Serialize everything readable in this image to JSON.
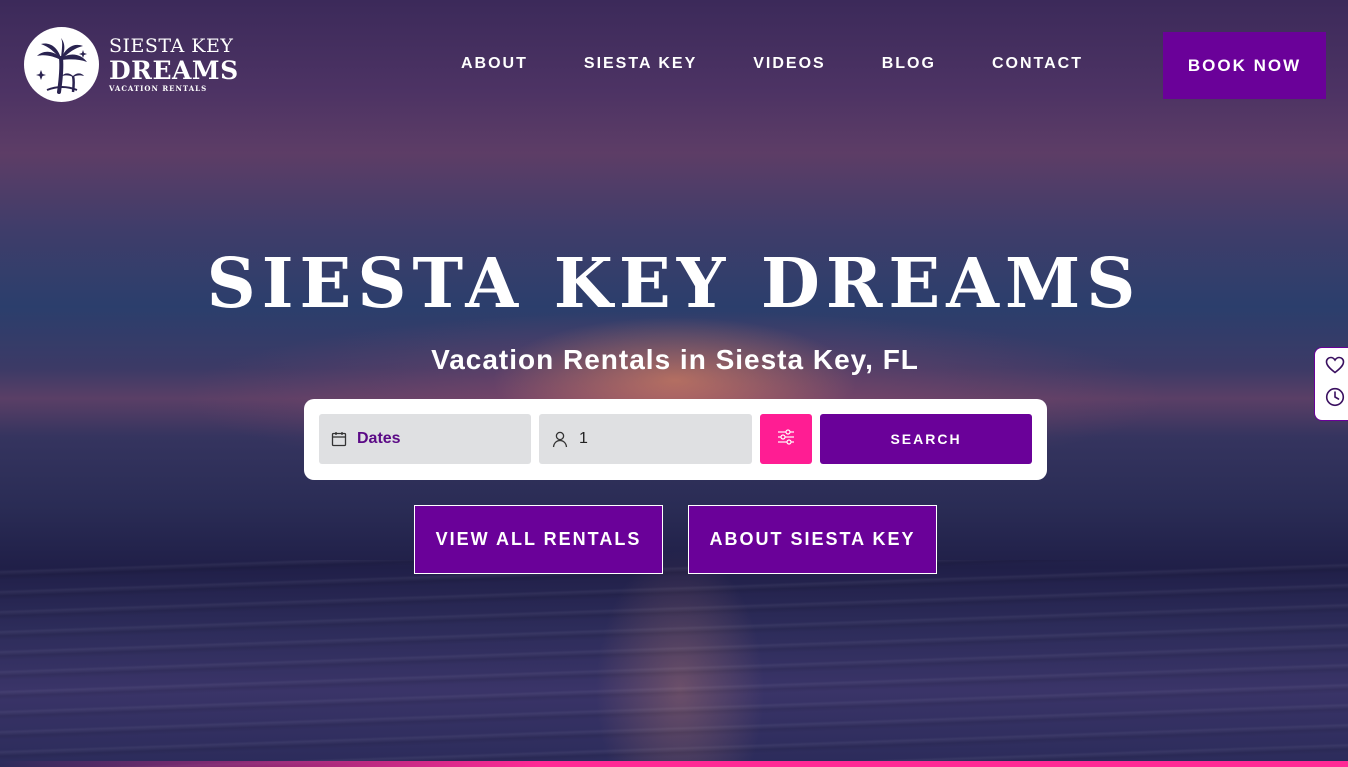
{
  "brand": {
    "line1": "SIESTA KEY",
    "line2": "DREAMS",
    "line3": "VACATION RENTALS",
    "logo_icon": "palm-tree-icon"
  },
  "nav": {
    "items": [
      {
        "label": "ABOUT"
      },
      {
        "label": "SIESTA KEY"
      },
      {
        "label": "VIDEOS"
      },
      {
        "label": "BLOG"
      },
      {
        "label": "CONTACT"
      }
    ],
    "book_now": "BOOK NOW"
  },
  "hero": {
    "title": "SIESTA KEY DREAMS",
    "subtitle": "Vacation Rentals in Siesta Key, FL"
  },
  "search": {
    "dates_label": "Dates",
    "dates_icon": "calendar-icon",
    "guests_value": "1",
    "guests_icon": "person-icon",
    "filter_icon": "sliders-icon",
    "search_label": "SEARCH"
  },
  "cta": {
    "rentals": "VIEW ALL RENTALS",
    "about": "ABOUT SIESTA KEY"
  },
  "side_widget": {
    "icons": [
      "heart-icon",
      "clock-icon"
    ]
  },
  "colors": {
    "brand_purple": "#6a0199",
    "accent_pink": "#ff1d93",
    "field_grey": "#dfe0e2"
  }
}
